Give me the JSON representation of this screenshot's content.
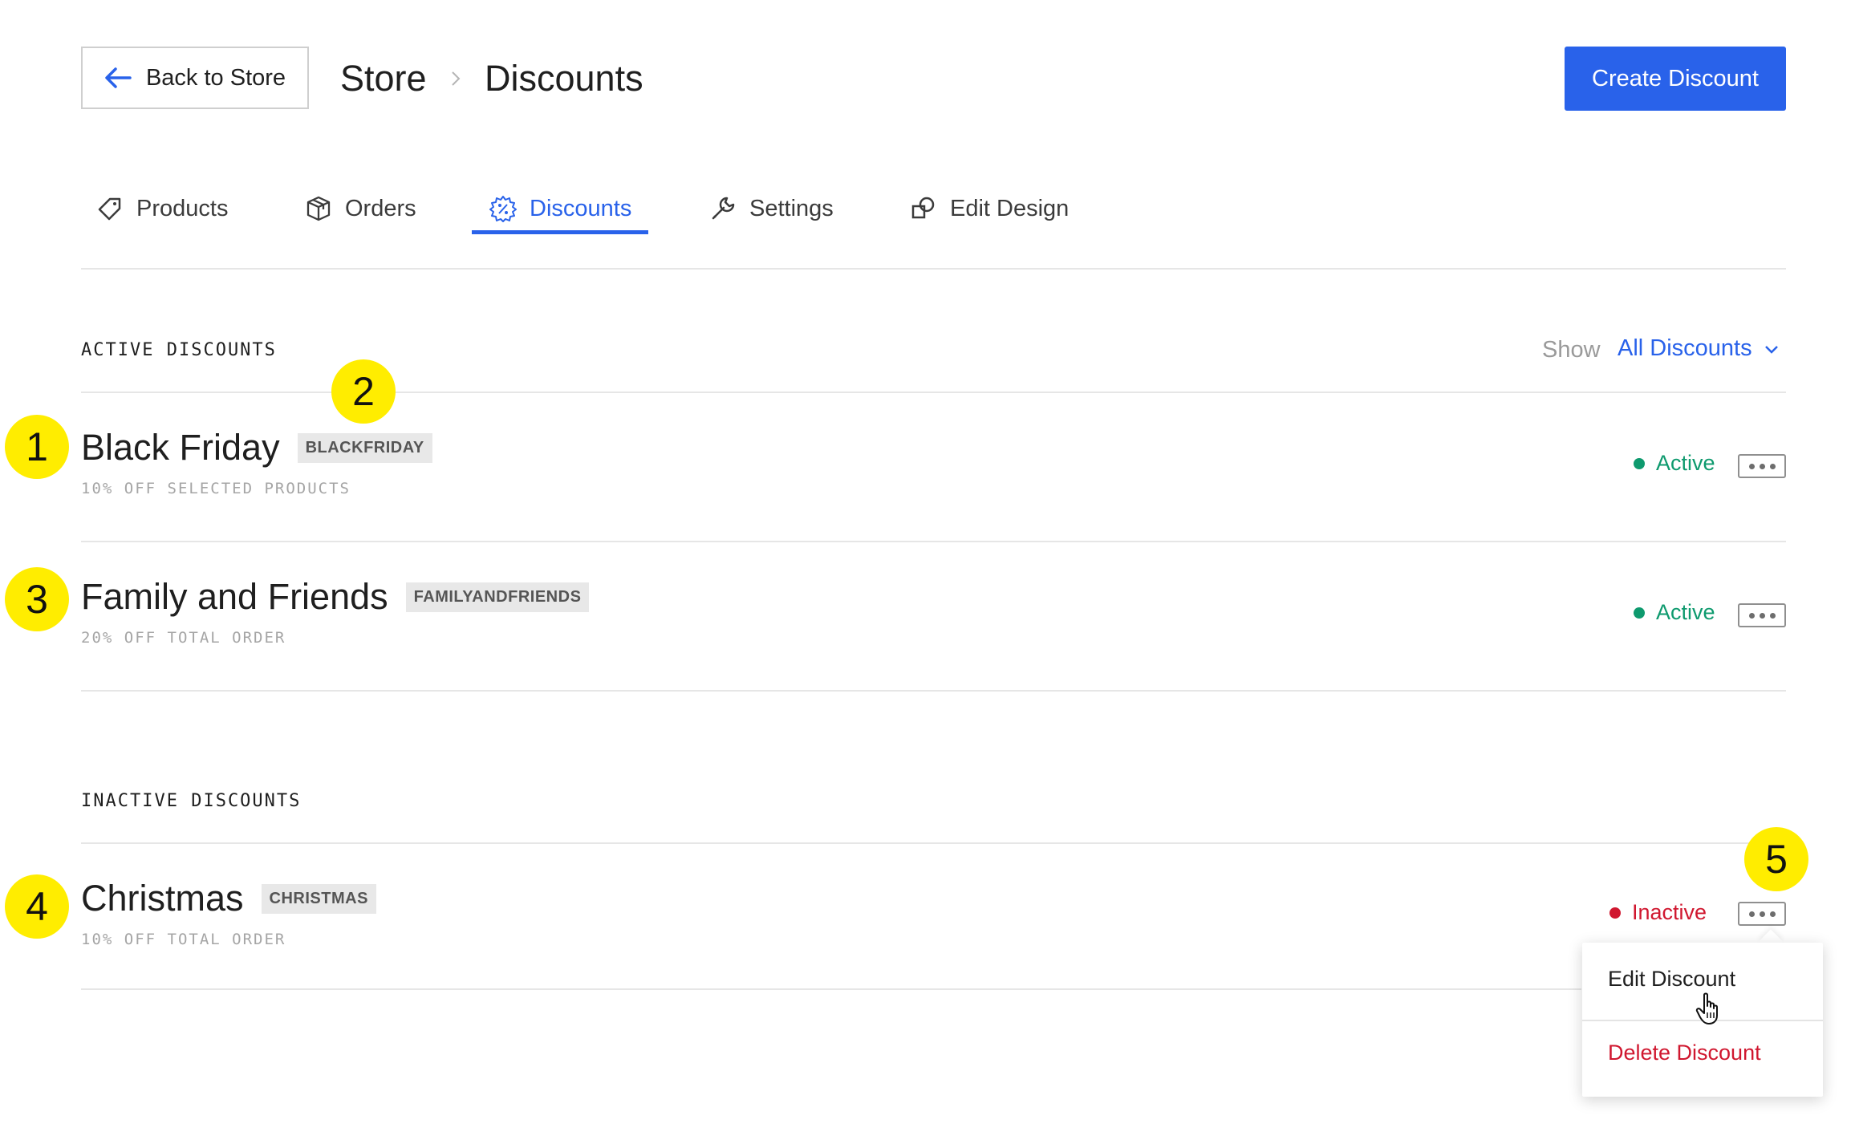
{
  "header": {
    "back_label": "Back to Store",
    "breadcrumb": {
      "store": "Store",
      "current": "Discounts"
    },
    "create_label": "Create Discount"
  },
  "tabs": [
    {
      "label": "Products",
      "icon": "tag-icon"
    },
    {
      "label": "Orders",
      "icon": "box-icon"
    },
    {
      "label": "Discounts",
      "icon": "discount-badge-icon",
      "active": true
    },
    {
      "label": "Settings",
      "icon": "wrench-icon"
    },
    {
      "label": "Edit Design",
      "icon": "shapes-icon"
    }
  ],
  "active_section": {
    "title": "ACTIVE DISCOUNTS",
    "show_label": "Show",
    "filter_value": "All Discounts",
    "items": [
      {
        "name": "Black Friday",
        "code": "BLACKFRIDAY",
        "description": "10% OFF SELECTED PRODUCTS",
        "status": "Active"
      },
      {
        "name": "Family and Friends",
        "code": "FAMILYANDFRIENDS",
        "description": "20% OFF TOTAL ORDER",
        "status": "Active"
      }
    ]
  },
  "inactive_section": {
    "title": "INACTIVE DISCOUNTS",
    "items": [
      {
        "name": "Christmas",
        "code": "CHRISTMAS",
        "description": "10% OFF TOTAL ORDER",
        "status": "Inactive"
      }
    ]
  },
  "menu": {
    "edit_label": "Edit Discount",
    "delete_label": "Delete Discount"
  },
  "badges": [
    "1",
    "2",
    "3",
    "4",
    "5"
  ],
  "colors": {
    "accent": "#2962ea",
    "active": "#0e9a6e",
    "inactive": "#d0172f",
    "badge": "#ffed00"
  }
}
